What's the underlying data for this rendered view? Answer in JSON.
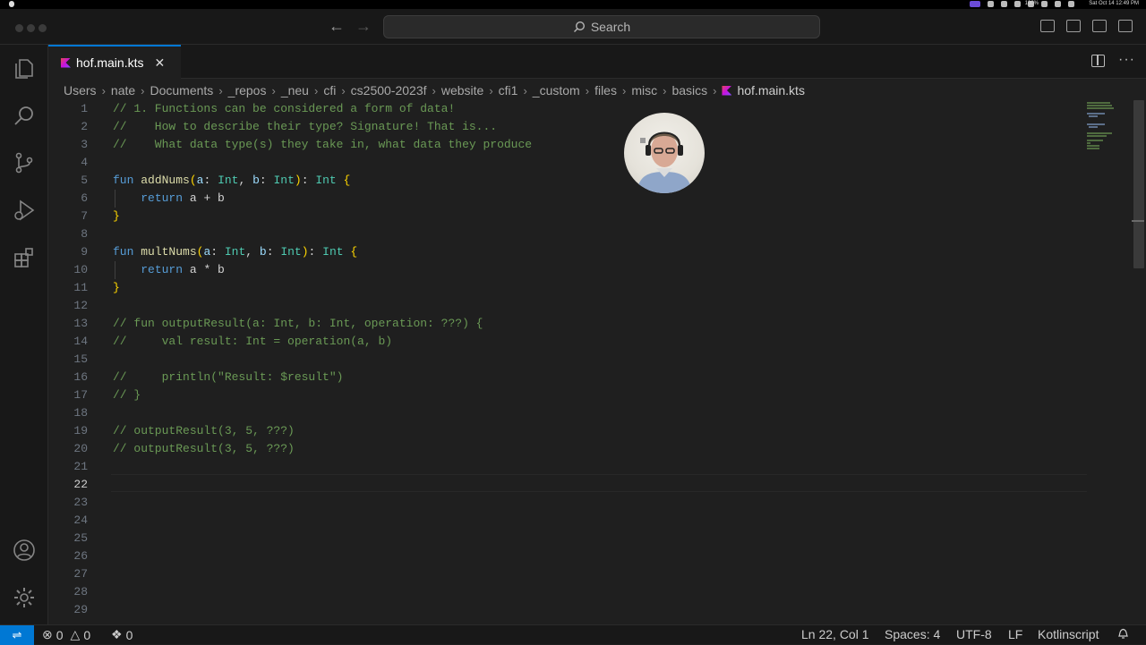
{
  "menubar": {
    "clock": "Sat Oct 14  12:49 PM",
    "battery": "100%"
  },
  "titlebar": {
    "search_placeholder": "Search",
    "back_icon": "arrow-left-icon",
    "forward_icon": "arrow-right-icon"
  },
  "tab": {
    "label": "hof.main.kts",
    "close_icon": "close-icon"
  },
  "breadcrumb": {
    "segments": [
      "Users",
      "nate",
      "Documents",
      "_repos",
      "_neu",
      "cfi",
      "cs2500-2023f",
      "website",
      "cfi1",
      "_custom",
      "files",
      "misc",
      "basics"
    ],
    "file": "hof.main.kts"
  },
  "editor": {
    "line_numbers": [
      "1",
      "2",
      "3",
      "4",
      "5",
      "6",
      "7",
      "8",
      "9",
      "10",
      "11",
      "12",
      "13",
      "14",
      "15",
      "16",
      "17",
      "18",
      "19",
      "20",
      "21",
      "22",
      "23",
      "24",
      "25",
      "26",
      "27",
      "28",
      "29"
    ],
    "current_line": "22",
    "lines": {
      "l1": "// 1. Functions can be considered a form of data!",
      "l2": "//    How to describe their type? Signature! That is...",
      "l3": "//    What data type(s) they take in, what data they produce",
      "l5_kw": "fun",
      "l5_fn": "addNums",
      "l5_p1": "a",
      "l5_t1": "Int",
      "l5_p2": "b",
      "l5_t2": "Int",
      "l5_rt": "Int",
      "l6_kw": "return",
      "l6_expr": "a + b",
      "l9_kw": "fun",
      "l9_fn": "multNums",
      "l9_p1": "a",
      "l9_t1": "Int",
      "l9_p2": "b",
      "l9_t2": "Int",
      "l9_rt": "Int",
      "l10_kw": "return",
      "l10_expr": "a * b",
      "l13": "// fun outputResult(a: Int, b: Int, operation: ???) {",
      "l14": "//     val result: Int = operation(a, b)",
      "l16": "//     println(\"Result: $result\")",
      "l17": "// }",
      "l19": "// outputResult(3, 5, ???)",
      "l20": "// outputResult(3, 5, ???)"
    }
  },
  "statusbar": {
    "errors": "0",
    "warnings": "0",
    "ports": "0",
    "position": "Ln 22, Col 1",
    "spaces": "Spaces: 4",
    "encoding": "UTF-8",
    "eol": "LF",
    "language": "Kotlinscript"
  },
  "colors": {
    "accent": "#0078d4",
    "comment": "#6a9955",
    "keyword": "#569cd6",
    "function": "#dcdcaa",
    "type": "#4ec9b0",
    "variable": "#9cdcfe",
    "bracket": "#ffd700"
  }
}
